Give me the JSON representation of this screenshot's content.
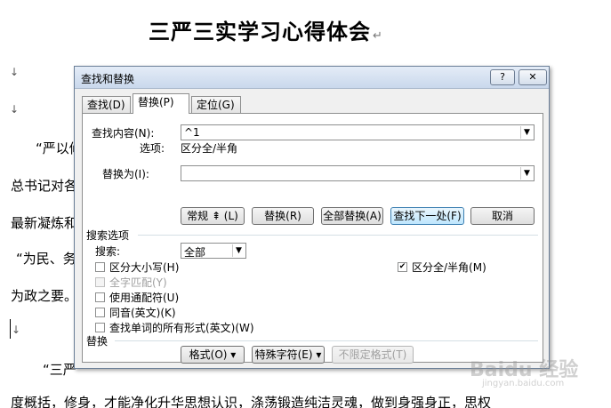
{
  "document": {
    "title": "三严三实学习心得体会",
    "lines": [
      "“严以修",
      "总书记对各",
      "最新凝炼和",
      "“为民、务",
      "为政之要。",
      "“三严",
      "度概括，修身，才能净化升华思想认识，涤荡锻造纯洁灵魂，做到身强身正，思权"
    ],
    "para_mark": "↵",
    "para_mark_down": "↓"
  },
  "dialog": {
    "title": "查找和替换",
    "help_label": "?",
    "close_label": "✕",
    "tabs": [
      {
        "label": "查找(D)",
        "active": false
      },
      {
        "label": "替换(P)",
        "active": true
      },
      {
        "label": "定位(G)",
        "active": false
      }
    ],
    "find_label": "查找内容(N):",
    "find_value": "^1",
    "options_label": "选项:",
    "options_value": "区分全/半角",
    "replace_label": "替换为(I):",
    "replace_value": "",
    "buttons": {
      "more": "常规 ⇞ (L)",
      "replace": "替换(R)",
      "replace_all": "全部替换(A)",
      "find_next": "查找下一处(F)",
      "cancel": "取消"
    },
    "search_options_label": "搜索选项",
    "search_label": "搜索:",
    "search_value": "全部",
    "checkboxes": [
      {
        "label": "区分大小写(H)",
        "checked": false,
        "disabled": false
      },
      {
        "label": "全字匹配(Y)",
        "checked": false,
        "disabled": true
      },
      {
        "label": "使用通配符(U)",
        "checked": false,
        "disabled": false
      },
      {
        "label": "同音(英文)(K)",
        "checked": false,
        "disabled": false
      },
      {
        "label": "查找单词的所有形式(英文)(W)",
        "checked": false,
        "disabled": false
      }
    ],
    "right_checkbox": {
      "label": "区分全/半角(M)",
      "checked": true
    },
    "replace_section_label": "替换",
    "bottom_buttons": {
      "format": "格式(O) ▾",
      "special": "特殊字符(E) ▾",
      "no_format": "不限定格式(T)"
    }
  },
  "watermark": {
    "text": "Baidu 经验",
    "sub": "jingyan.baidu.com"
  }
}
